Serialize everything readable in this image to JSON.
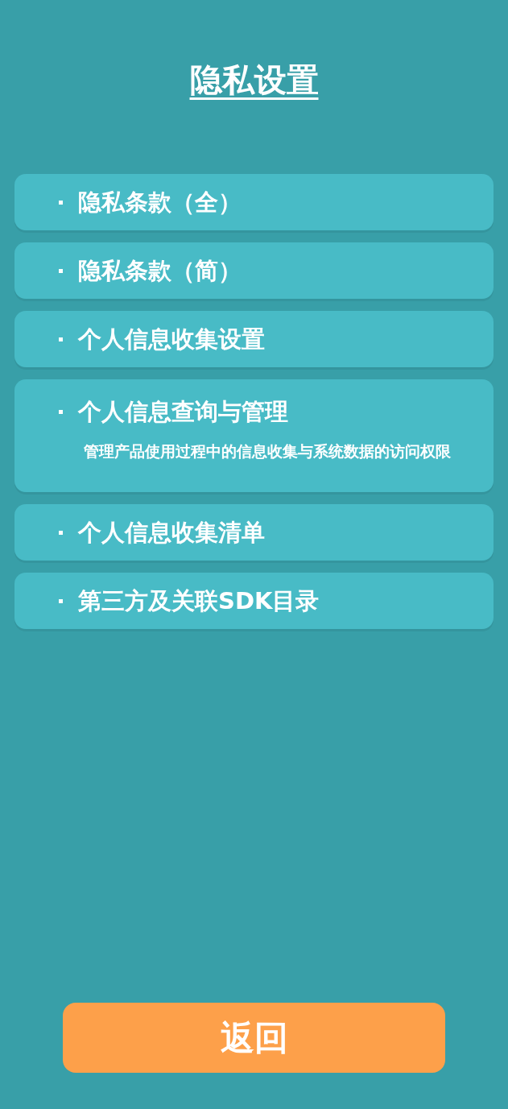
{
  "title": "隐私设置",
  "menu_items": [
    {
      "label": "隐私条款（全）"
    },
    {
      "label": "隐私条款（简）"
    },
    {
      "label": "个人信息收集设置"
    },
    {
      "label": "个人信息查询与管理",
      "description": "管理产品使用过程中的信息收集与系统数据的访问权限"
    },
    {
      "label": "个人信息收集清单"
    },
    {
      "label": "第三方及关联SDK目录"
    }
  ],
  "back_button": "返回"
}
